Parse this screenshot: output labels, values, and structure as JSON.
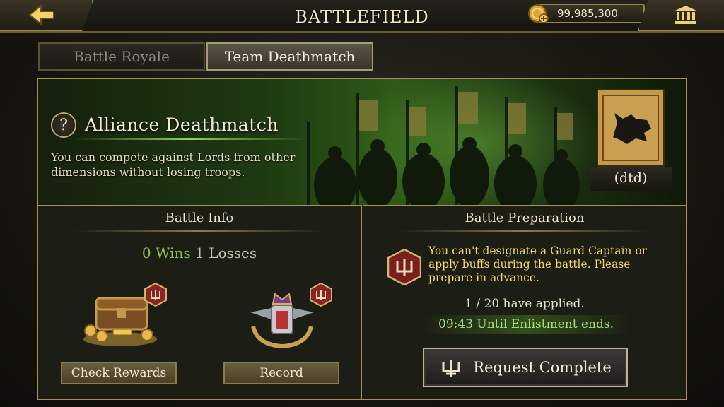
{
  "header": {
    "title": "BATTLEFIELD",
    "gold": "99,985,300"
  },
  "tabs": [
    {
      "label": "Battle Royale",
      "active": false
    },
    {
      "label": "Team Deathmatch",
      "active": true
    }
  ],
  "banner": {
    "title": "Alliance Deathmatch",
    "description": "You can compete against Lords from other dimensions without losing troops.",
    "alliance_tag": "(dtd)"
  },
  "battle_info": {
    "title": "Battle Info",
    "wins_count": "0",
    "wins_label": "Wins",
    "losses_count": "1",
    "losses_label": "Losses",
    "check_rewards_label": "Check Rewards",
    "record_label": "Record"
  },
  "battle_prep": {
    "title": "Battle Preparation",
    "notice": "You can't designate a Guard Captain or apply buffs during the battle. Please prepare in advance.",
    "applied": "1 / 20 have applied.",
    "timer": "09:43 Until Enlistment ends.",
    "request_label": "Request Complete"
  },
  "colors": {
    "wins": "#8ac24a",
    "notice": "#f3d86a",
    "timer": "#a8e07a",
    "border_gold": "#a48e5c"
  }
}
